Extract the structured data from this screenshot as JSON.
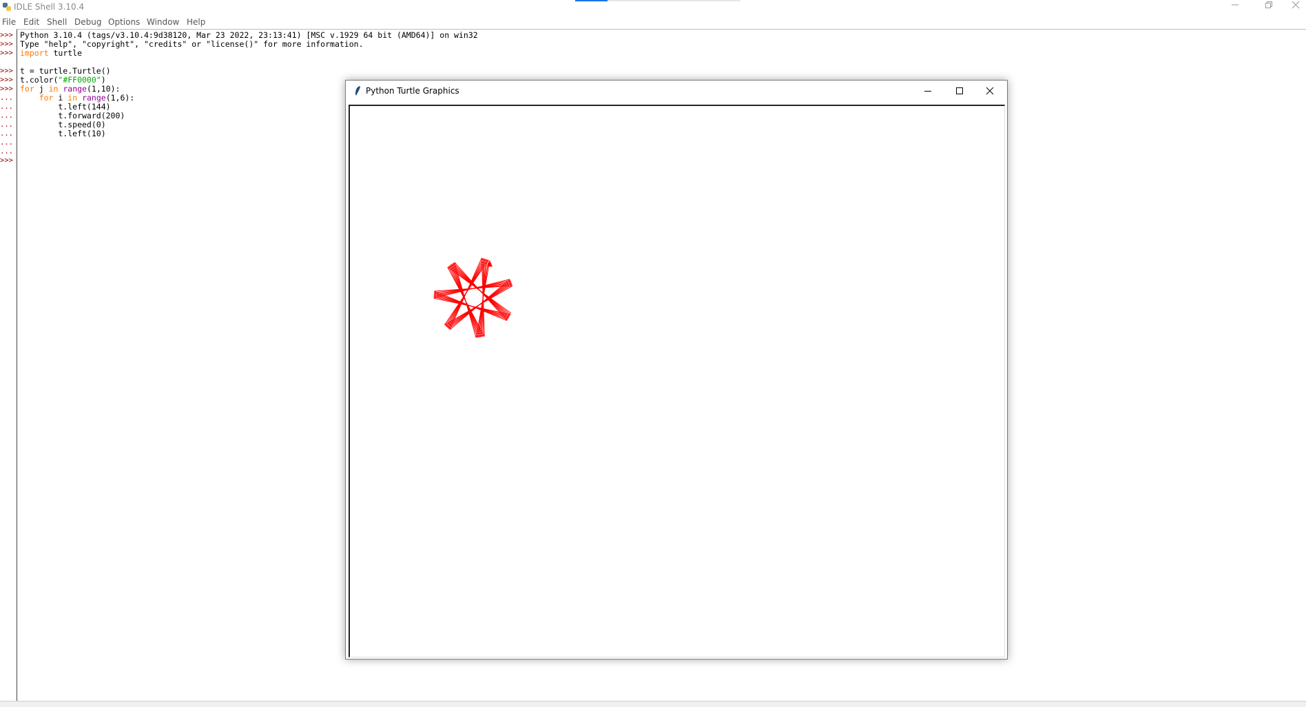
{
  "window": {
    "title": "IDLE Shell 3.10.4"
  },
  "menu": [
    "File",
    "Edit",
    "Shell",
    "Debug",
    "Options",
    "Window",
    "Help"
  ],
  "shell": {
    "gutter": [
      ">>>",
      ">>>",
      ">>>",
      "",
      ">>>",
      ">>>",
      ">>>",
      "...",
      "...",
      "...",
      "...",
      "...",
      "...",
      "...",
      ">>>"
    ],
    "lines": [
      [
        {
          "t": "Python 3.10.4 (tags/v3.10.4:9d38120, Mar 23 2022, 23:13:41) [MSC v.1929 64 bit (AMD64)] on win32"
        }
      ],
      [
        {
          "t": "Type \"help\", \"copyright\", \"credits\" or \"license()\" for more information."
        }
      ],
      [
        {
          "t": "import",
          "c": "kw"
        },
        {
          "t": " turtle"
        }
      ],
      [
        {
          "t": ""
        }
      ],
      [
        {
          "t": "t = turtle.Turtle()"
        }
      ],
      [
        {
          "t": "t.color("
        },
        {
          "t": "\"#FF0000\"",
          "c": "str"
        },
        {
          "t": ")"
        }
      ],
      [
        {
          "t": "for",
          "c": "kw"
        },
        {
          "t": " j "
        },
        {
          "t": "in",
          "c": "kw"
        },
        {
          "t": " "
        },
        {
          "t": "range",
          "c": "bi"
        },
        {
          "t": "(1,10):"
        }
      ],
      [
        {
          "t": "    "
        },
        {
          "t": "for",
          "c": "kw"
        },
        {
          "t": " i "
        },
        {
          "t": "in",
          "c": "kw"
        },
        {
          "t": " "
        },
        {
          "t": "range",
          "c": "bi"
        },
        {
          "t": "(1,6):"
        }
      ],
      [
        {
          "t": "        t.left(144)"
        }
      ],
      [
        {
          "t": "        t.forward(200)"
        }
      ],
      [
        {
          "t": "        t.speed(0)"
        }
      ],
      [
        {
          "t": "        t.left(10)"
        }
      ],
      [
        {
          "t": ""
        }
      ],
      [
        {
          "t": ""
        }
      ],
      [
        {
          "t": ""
        }
      ]
    ]
  },
  "turtle_window": {
    "title": "Python Turtle Graphics",
    "pen_color": "#FF0000",
    "program": {
      "outer_loops": 9,
      "inner_loops": 5,
      "turn_in_loop": 144,
      "forward": 200,
      "turn_after": 10
    }
  },
  "colors": {
    "keyword": "#ff7700",
    "builtin": "#900090",
    "string": "#00aa00",
    "prompt": "#990000"
  }
}
